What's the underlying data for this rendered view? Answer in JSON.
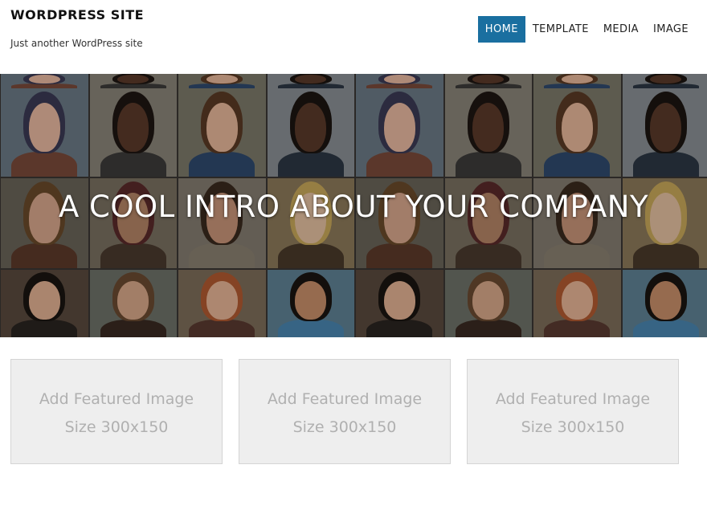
{
  "header": {
    "site_title": "WORDPRESS SITE",
    "tagline": "Just another WordPress site"
  },
  "nav": {
    "items": [
      {
        "label": "HOME",
        "active": true
      },
      {
        "label": "TEMPLATE",
        "active": false
      },
      {
        "label": "MEDIA",
        "active": false
      },
      {
        "label": "IMAGE",
        "active": false
      }
    ]
  },
  "hero": {
    "heading": "A COOL INTRO ABOUT YOUR COMPANY"
  },
  "features": [
    {
      "line1": "Add Featured Image",
      "line2": "Size 300x150"
    },
    {
      "line1": "Add Featured Image",
      "line2": "Size 300x150"
    },
    {
      "line1": "Add Featured Image",
      "line2": "Size 300x150"
    }
  ],
  "colors": {
    "accent": "#1a6fa0",
    "placeholder_bg": "#eeeeee",
    "placeholder_text": "#b0b0b0"
  }
}
